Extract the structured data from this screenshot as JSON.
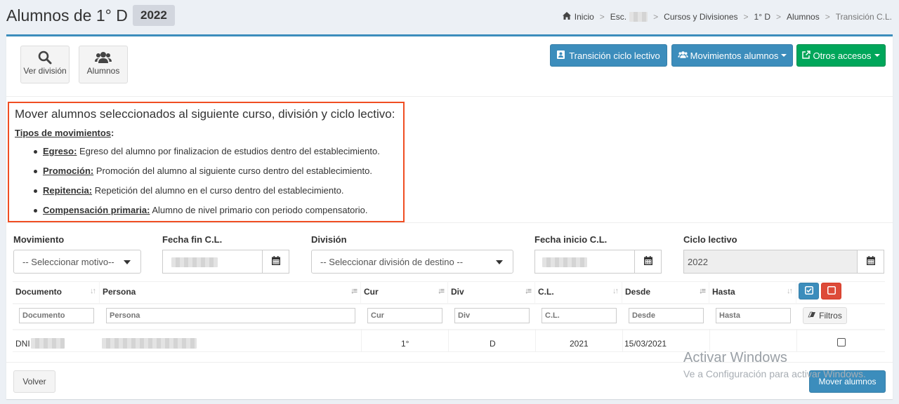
{
  "header": {
    "title": "Alumnos de 1° D -",
    "year_badge": "2022"
  },
  "breadcrumb": {
    "home_icon": "home-icon",
    "items": [
      "Inicio",
      "Esc.",
      "Cursos y Divisiones",
      "1° D",
      "Alumnos",
      "Transición C.L."
    ]
  },
  "toolbar": {
    "ver_division": {
      "label": "Ver división",
      "icon": "search-icon"
    },
    "alumnos": {
      "label": "Alumnos",
      "icon": "users-icon"
    },
    "transicion": {
      "label": "Transición ciclo lectivo",
      "icon": "id-card-icon"
    },
    "movimientos": {
      "label": "Movimientos alumnos",
      "icon": "users-icon"
    },
    "otros": {
      "label": "Otros accesos",
      "icon": "external-link-icon"
    }
  },
  "info": {
    "title": "Mover alumnos seleccionados al siguiente curso, división y ciclo lectivo:",
    "subtitle": "Tipos de movimientos",
    "items": [
      {
        "term": "Egreso",
        "desc": "Egreso del alumno por finalizacion de estudios dentro del establecimiento."
      },
      {
        "term": "Promoción",
        "desc": "Promoción del alumno al siguiente curso dentro del establecimiento."
      },
      {
        "term": "Repitencia",
        "desc": "Repetición del alumno en el curso dentro del establecimiento."
      },
      {
        "term": "Compensación primaria",
        "desc": "Alumno de nivel primario con periodo compensatorio."
      }
    ]
  },
  "form": {
    "movimiento": {
      "label": "Movimiento",
      "value": "-- Seleccionar motivo--"
    },
    "fecha_fin": {
      "label": "Fecha fin C.L."
    },
    "division": {
      "label": "División",
      "value": "-- Seleccionar división de destino --"
    },
    "fecha_inicio": {
      "label": "Fecha inicio C.L."
    },
    "ciclo": {
      "label": "Ciclo lectivo",
      "value": "2022"
    }
  },
  "table": {
    "columns": [
      "Documento",
      "Persona",
      "Cur",
      "Div",
      "C.L.",
      "Desde",
      "Hasta"
    ],
    "filters": [
      "Documento",
      "Persona",
      "Cur",
      "Div",
      "C.L.",
      "Desde",
      "Hasta"
    ],
    "filtros_label": "Filtros",
    "rows": [
      {
        "documento": "DNI",
        "cur": "1°",
        "div": "D",
        "cl": "2021",
        "desde": "15/03/2021",
        "hasta": ""
      }
    ]
  },
  "footer": {
    "volver": "Volver",
    "mover": "Mover alumnos"
  },
  "watermark": {
    "line1": "Activar Windows",
    "line2": "Ve a Configuración para activar Windows."
  },
  "colors": {
    "primary": "#3c8dbc",
    "success": "#00a65a",
    "danger": "#dd4b39",
    "highlight_border": "#f04e23"
  }
}
